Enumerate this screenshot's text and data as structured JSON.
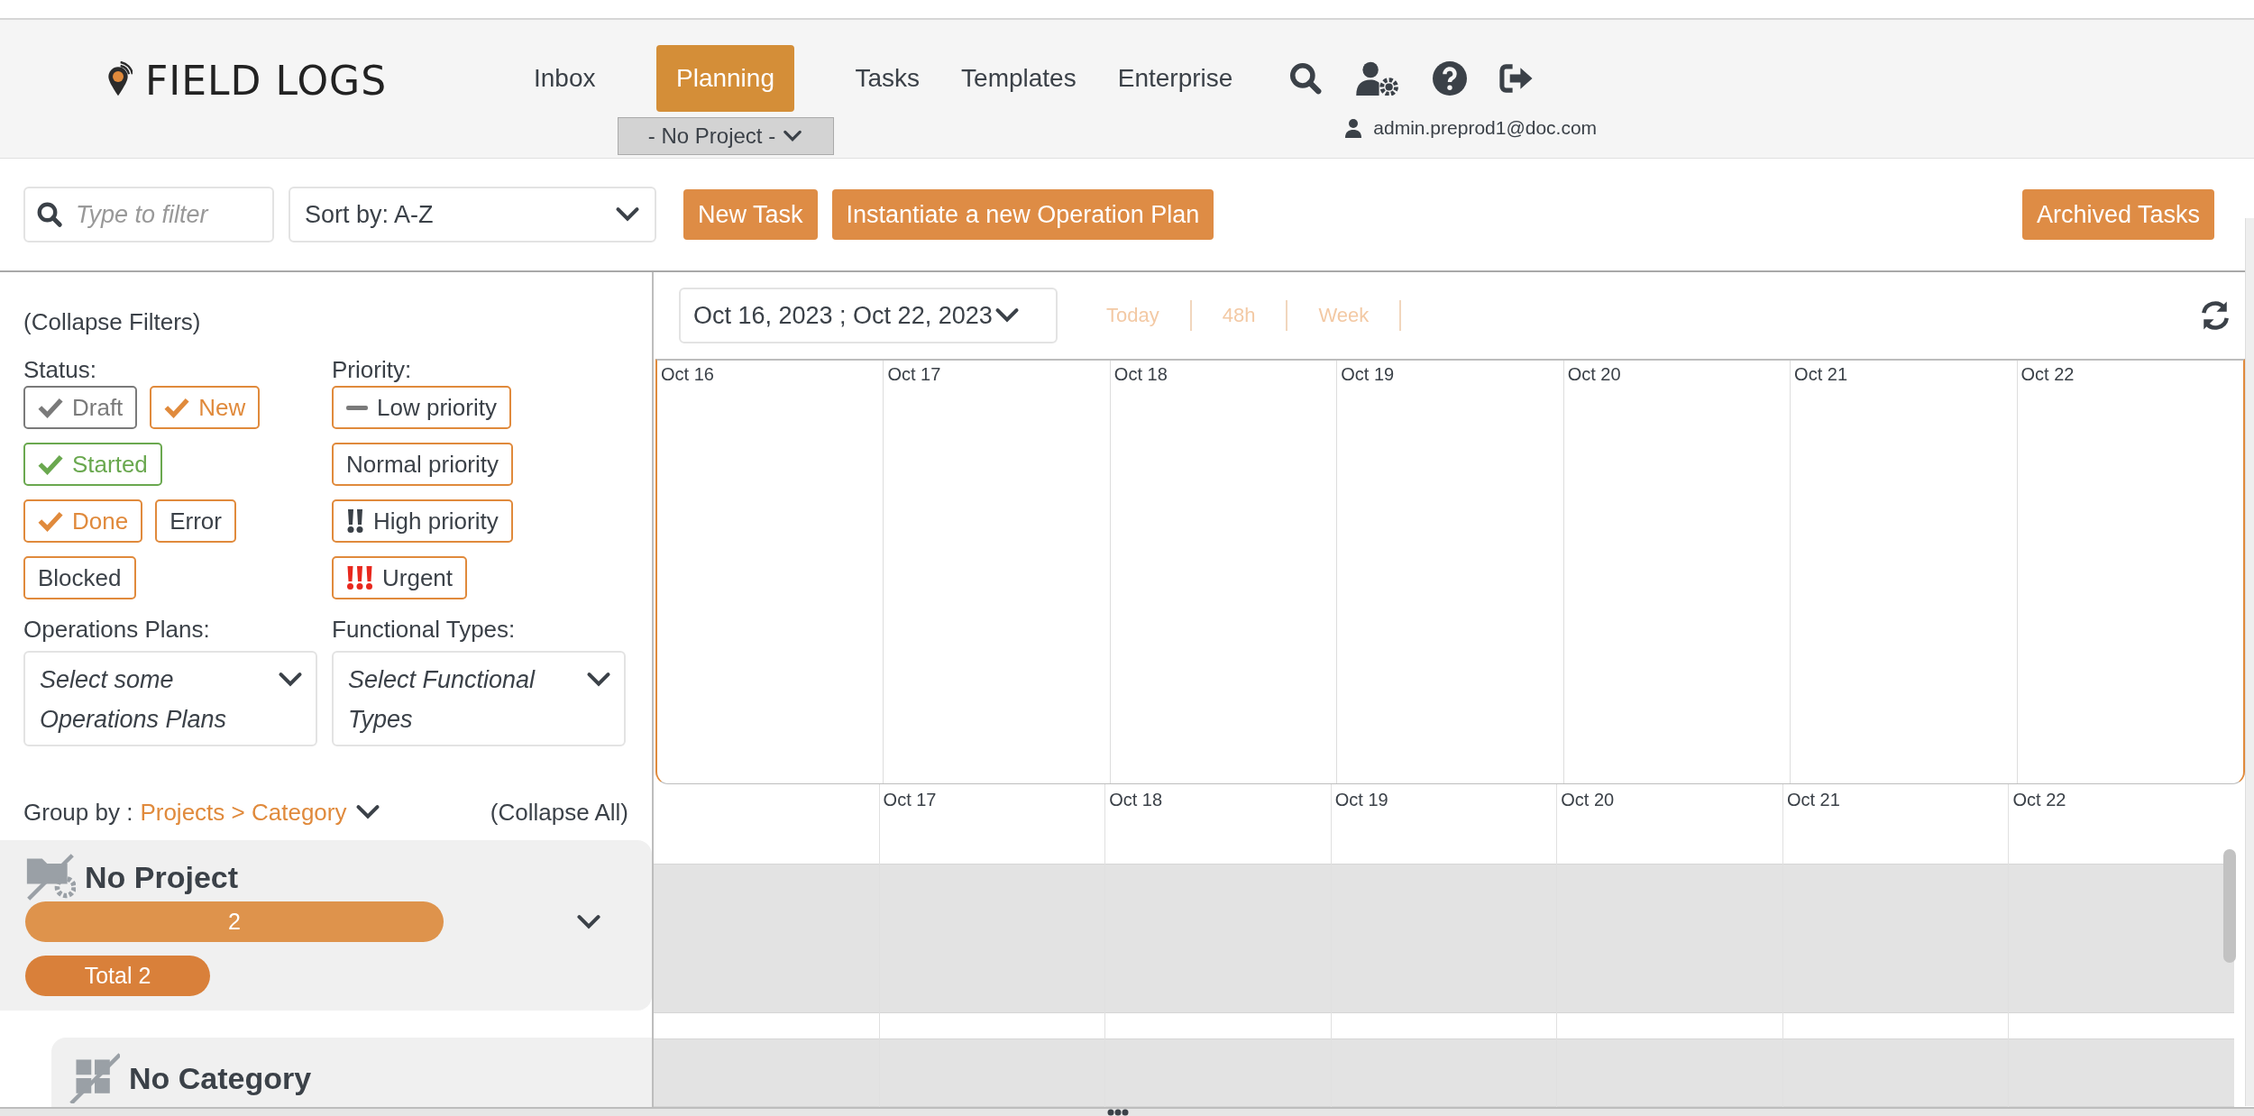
{
  "header": {
    "logo": "FIELD LOGS",
    "nav": [
      {
        "label": "Inbox",
        "selected": false
      },
      {
        "label": "Planning",
        "selected": true,
        "dropdown": "- No Project -"
      },
      {
        "label": "Tasks",
        "selected": false
      },
      {
        "label": "Templates",
        "selected": false
      },
      {
        "label": "Enterprise",
        "selected": false
      }
    ],
    "user": "admin.preprod1@doc.com"
  },
  "toolbar": {
    "filter": {
      "placeholder": "Type to filter"
    },
    "sort": "Sort by: A-Z",
    "buttons": [
      "New Task",
      "Instantiate a new Operation Plan"
    ],
    "archived_button": "Archived Tasks"
  },
  "filters": {
    "collapse": "(Collapse Filters)",
    "status_label": "Status:",
    "priority_label": "Priority:",
    "statuses": [
      {
        "label": "Draft",
        "checked": true,
        "color": "#7a7a7a"
      },
      {
        "label": "New",
        "checked": true,
        "color": "#e08a3c"
      },
      {
        "label": "Started",
        "checked": true,
        "color": "#6aa84f"
      },
      {
        "label": "Done",
        "checked": true,
        "color": "#e08a3c"
      },
      {
        "label": "Error",
        "checked": false,
        "color": "#e08a3c"
      },
      {
        "label": "Blocked",
        "checked": false,
        "color": "#e08a3c"
      }
    ],
    "priorities": [
      {
        "label": "Low priority",
        "kind": "low"
      },
      {
        "label": "Normal priority",
        "kind": "normal"
      },
      {
        "label": "High priority",
        "kind": "high"
      },
      {
        "label": "Urgent",
        "kind": "urgent"
      }
    ],
    "selects": [
      {
        "label": "Operations Plans:",
        "placeholder": "Select some Operations Plans"
      },
      {
        "label": "Functional Types:",
        "placeholder": "Select Functional Types"
      }
    ]
  },
  "gantt": {
    "date_range": "Oct 16, 2023 ; Oct 22, 2023",
    "ranges": [
      "Today",
      "48h",
      "Week"
    ],
    "days": [
      "Oct 16",
      "Oct 17",
      "Oct 18",
      "Oct 19",
      "Oct 20",
      "Oct 21",
      "Oct 22"
    ]
  },
  "grouping": {
    "label": "Group by :",
    "value": "Projects > Category",
    "collapse_all": "(Collapse All)",
    "groups": [
      {
        "name": "No Project",
        "count": "2",
        "total": "Total 2",
        "children": [
          {
            "name": "No Category"
          }
        ]
      }
    ]
  },
  "timeline": {
    "days": [
      "Oct 17",
      "Oct 18",
      "Oct 19",
      "Oct 20",
      "Oct 21",
      "Oct 22"
    ]
  }
}
